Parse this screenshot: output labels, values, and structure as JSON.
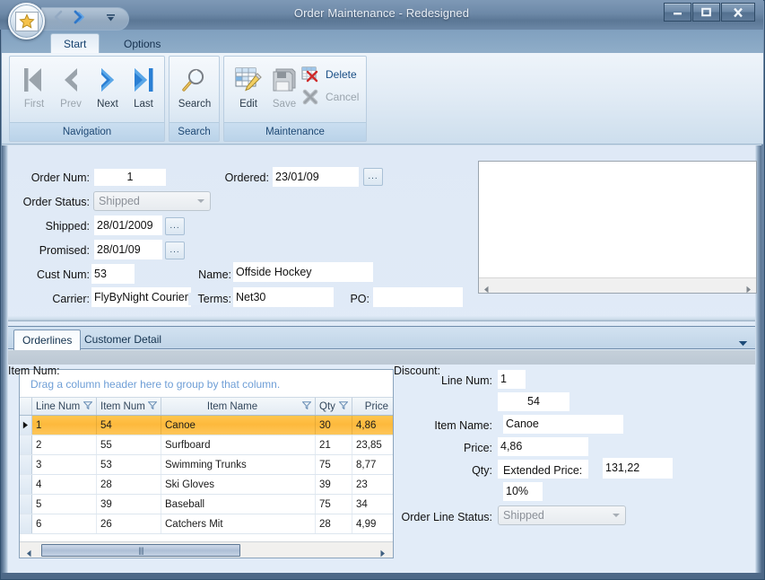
{
  "window": {
    "title": "Order Maintenance - Redesigned",
    "app_button_icon": "star-icon",
    "minimize_label": "Minimize",
    "maximize_label": "Maximize",
    "close_label": "Close",
    "quick_access": {
      "back_icon": "chevron-left-icon",
      "forward_icon": "chevron-right-icon",
      "customize_icon": "chevron-down-icon"
    }
  },
  "ribbon": {
    "tabs": [
      {
        "label": "Start",
        "active": true
      },
      {
        "label": "Options",
        "active": false
      }
    ],
    "groups": [
      {
        "label": "Navigation",
        "buttons": [
          {
            "label": "First",
            "icon": "first-record-icon",
            "enabled": false
          },
          {
            "label": "Prev",
            "icon": "prev-record-icon",
            "enabled": false
          },
          {
            "label": "Next",
            "icon": "next-record-icon",
            "enabled": true
          },
          {
            "label": "Last",
            "icon": "last-record-icon",
            "enabled": true
          }
        ]
      },
      {
        "label": "Search",
        "buttons": [
          {
            "label": "Search",
            "icon": "magnifier-icon",
            "enabled": true
          }
        ]
      },
      {
        "label": "Maintenance",
        "buttons": [
          {
            "label": "Edit",
            "icon": "grid-pencil-icon",
            "enabled": true
          },
          {
            "label": "Save",
            "icon": "floppy-disk-icon",
            "enabled": false
          }
        ],
        "small_buttons": [
          {
            "label": "Delete",
            "icon": "grid-delete-icon",
            "enabled": true
          },
          {
            "label": "Cancel",
            "icon": "cancel-x-icon",
            "enabled": false
          }
        ]
      }
    ]
  },
  "order_form": {
    "order_num": {
      "label": "Order Num:",
      "value": "1"
    },
    "ordered": {
      "label": "Ordered:",
      "value": "23/01/09",
      "picker_label": "..."
    },
    "order_status": {
      "label": "Order Status:",
      "value": "Shipped"
    },
    "shipped": {
      "label": "Shipped:",
      "value": "28/01/2009",
      "picker_label": "..."
    },
    "promised": {
      "label": "Promised:",
      "value": "28/01/09",
      "picker_label": "..."
    },
    "cust_num": {
      "label": "Cust Num:",
      "value": "53"
    },
    "name": {
      "label": "Name:",
      "value": "Offside Hockey"
    },
    "carrier": {
      "label": "Carrier:",
      "value": "FlyByNight Courier"
    },
    "terms": {
      "label": "Terms:",
      "value": "Net30"
    },
    "po": {
      "label": "PO:",
      "value": ""
    }
  },
  "detail_tabs": [
    {
      "label": "Orderlines",
      "active": true
    },
    {
      "label": "Customer Detail",
      "active": false
    }
  ],
  "grid": {
    "group_hint": "Drag a column header here to group by that column.",
    "columns": [
      {
        "label": "Line Num",
        "filter": true,
        "align": "left",
        "width": 72
      },
      {
        "label": "Item Num",
        "filter": true,
        "align": "left",
        "width": 72
      },
      {
        "label": "Item Name",
        "filter": true,
        "align": "center",
        "width": 172
      },
      {
        "label": "Qty",
        "filter": true,
        "align": "center",
        "width": 41
      },
      {
        "label": "Price",
        "filter": false,
        "align": "right",
        "width": 45
      }
    ],
    "rows": [
      {
        "selected": true,
        "cells": [
          "1",
          "54",
          "Canoe",
          "30",
          "4,86"
        ]
      },
      {
        "selected": false,
        "cells": [
          "2",
          "55",
          "Surfboard",
          "21",
          "23,85"
        ]
      },
      {
        "selected": false,
        "cells": [
          "3",
          "53",
          "Swimming Trunks",
          "75",
          "8,77"
        ]
      },
      {
        "selected": false,
        "cells": [
          "4",
          "28",
          "Ski Gloves",
          "39",
          "23"
        ]
      },
      {
        "selected": false,
        "cells": [
          "5",
          "39",
          "Baseball",
          "75",
          "34"
        ]
      },
      {
        "selected": false,
        "cells": [
          "6",
          "26",
          "Catchers Mit",
          "28",
          "4,99"
        ]
      }
    ]
  },
  "line_detail": {
    "line_num": {
      "label": "Line Num:",
      "value": "1"
    },
    "item_num": {
      "label": "Item Num:",
      "value": "54"
    },
    "item_name": {
      "label": "Item Name:",
      "value": "Canoe"
    },
    "price": {
      "label": "Price:",
      "value": "4,86"
    },
    "qty": {
      "label": "Qty:",
      "value": ""
    },
    "extended_price": {
      "label": "Extended Price:",
      "value": "131,22"
    },
    "discount": {
      "label": "Discount:",
      "value": "10%"
    },
    "order_line_status": {
      "label": "Order Line Status:",
      "value": "Shipped"
    }
  },
  "colors": {
    "selection_orange": "#fdb93c",
    "link_blue": "#1a4f86",
    "hint_blue": "#6e9ed6",
    "frame_blue": "#56708f",
    "client_bg": "#e2ecf8"
  }
}
